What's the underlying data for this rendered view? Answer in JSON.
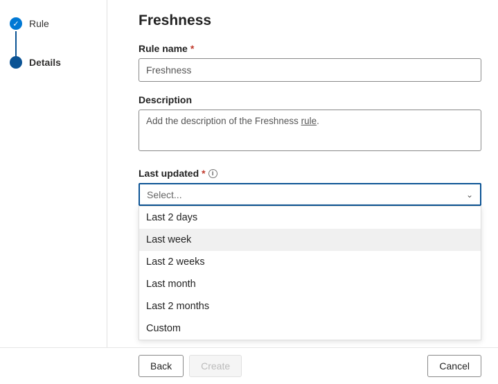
{
  "sidebar": {
    "steps": [
      {
        "label": "Rule",
        "state": "done"
      },
      {
        "label": "Details",
        "state": "current"
      }
    ]
  },
  "main": {
    "title": "Freshness",
    "ruleName": {
      "label": "Rule name",
      "value": "Freshness"
    },
    "description": {
      "label": "Description",
      "prefix": "Add the description of the Freshness ",
      "linkword": "rule",
      "suffix": "."
    },
    "lastUpdated": {
      "label": "Last updated",
      "placeholder": "Select...",
      "options": [
        "Last 2 days",
        "Last week",
        "Last 2 weeks",
        "Last month",
        "Last 2 months",
        "Custom"
      ],
      "hoveredIndex": 1
    }
  },
  "footer": {
    "back": "Back",
    "create": "Create",
    "cancel": "Cancel"
  }
}
